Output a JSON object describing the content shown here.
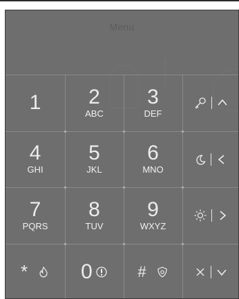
{
  "menu_title": "Menu",
  "keys": [
    {
      "digit": "1",
      "letters": ""
    },
    {
      "digit": "2",
      "letters": "ABC"
    },
    {
      "digit": "3",
      "letters": "DEF"
    },
    {
      "digit": "4",
      "letters": "GHI"
    },
    {
      "digit": "5",
      "letters": "JKL"
    },
    {
      "digit": "6",
      "letters": "MNO"
    },
    {
      "digit": "7",
      "letters": "PQRS"
    },
    {
      "digit": "8",
      "letters": "TUV"
    },
    {
      "digit": "9",
      "letters": "WXYZ"
    }
  ],
  "bottom_row": {
    "star": "*",
    "zero": "0",
    "hash": "#"
  },
  "side_column": [
    {
      "left_icon": "key-icon",
      "right_icon": "chevron-up-icon"
    },
    {
      "left_icon": "moon-icon",
      "right_icon": "chevron-left-icon"
    },
    {
      "left_icon": "sun-icon",
      "right_icon": "chevron-right-icon"
    },
    {
      "left_icon": "close-icon",
      "right_icon": "chevron-down-icon"
    }
  ],
  "colors": {
    "panel": "#6e6e6e",
    "text": "#ececec",
    "grid": "#8a8a8a"
  }
}
